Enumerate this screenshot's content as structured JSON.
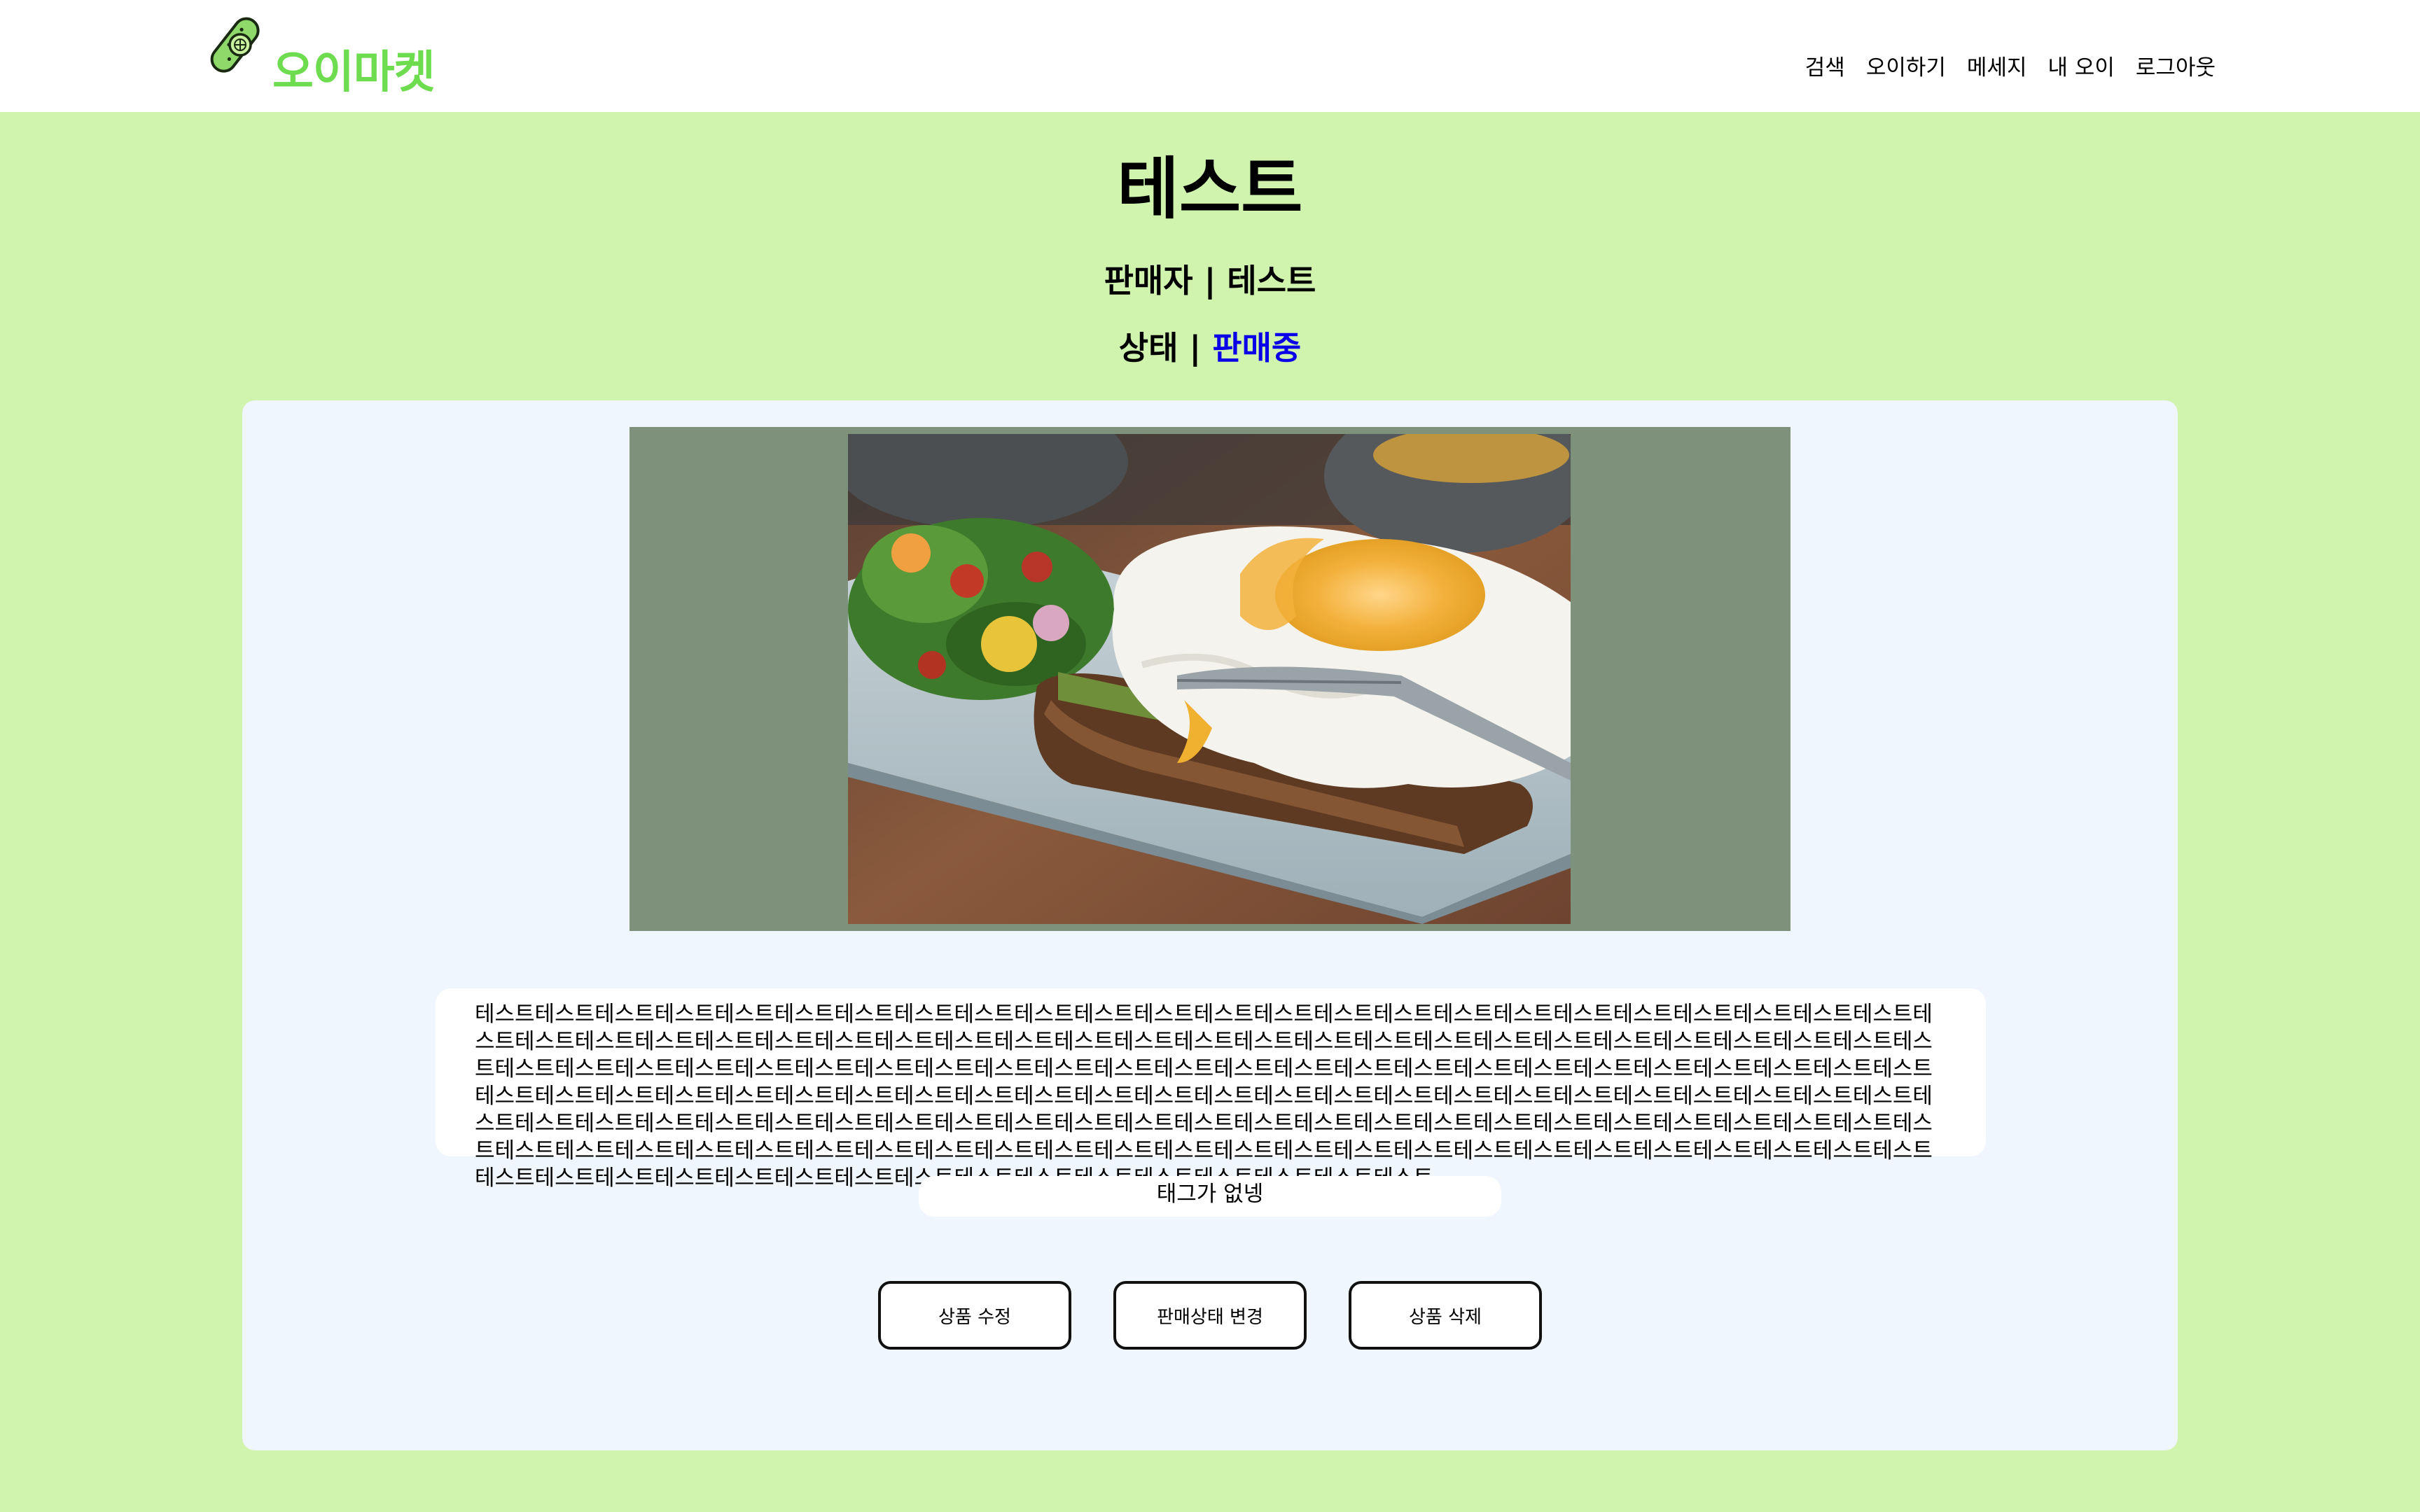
{
  "header": {
    "brand_name": "오이마켓",
    "nav": [
      "검색",
      "오이하기",
      "메세지",
      "내 오이",
      "로그아웃"
    ]
  },
  "product": {
    "title": "테스트",
    "seller_label": "판매자",
    "seller_name": "테스트",
    "status_label": "상태",
    "status_value": "판매중",
    "separator": "|",
    "description": "테스트테스트테스트테스트테스트테스트테스트테스트테스트테스트테스트테스트테스트테스트테스트테스트테스트테스트테스트테스트테스트테스트테스트테스트테스트테스트테스트테스트테스트테스트테스트테스트테스트테스트테스트테스트테스트테스트테스트테스트테스트테스트테스트테스트테스트테스트테스트테스트테스트테스트테스트테스트테스트테스트테스트테스트테스트테스트테스트테스트테스트테스트테스트테스트테스트테스트테스트테스트테스트테스트테스트테스트테스트테스트테스트테스트테스트테스트테스트테스트테스트테스트테스트테스트테스트테스트테스트테스트테스트테스트테스트테스트테스트테스트테스트테스트테스트테스트테스트테스트테스트테스트테스트테스트테스트테스트테스트테스트테스트테스트테스트테스트테스트테스트테스트테스트테스트테스트테스트테스트테스트테스트테스트테스트테스트테스트테스트테스트테스트테스트테스트테스트테스트테스트테스트테스트테스트테스트테스트테스트테스트테스트테스트테스트테스트테스트테스트테스트테스트테스트테스트테스트테스트테스트테스트테스트테스트테스트테스트테스트테스트테스트",
    "tags_text": "태그가 없넹",
    "image_icon": "food-photo-avocado-toast-egg"
  },
  "actions": {
    "edit_label": "상품 수정",
    "status_change_label": "판매상태 변경",
    "delete_label": "상품 삭제"
  },
  "colors": {
    "page_background": "#d0f4ae",
    "header_background": "#ffffff",
    "brand": "#6ddc4e",
    "card_background": "#eff6fd",
    "image_frame": "#7e917b",
    "status_value": "#0a00e8"
  }
}
